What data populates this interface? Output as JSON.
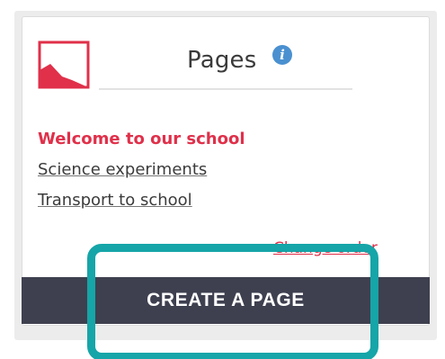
{
  "widget": {
    "title": "Pages",
    "info_icon": "info-icon",
    "info_glyph": "i"
  },
  "pages": {
    "items": [
      {
        "label": "Welcome to our school",
        "current": true
      },
      {
        "label": "Science experiments",
        "current": false
      },
      {
        "label": "Transport to school",
        "current": false
      }
    ],
    "change_order_label": "Change order"
  },
  "actions": {
    "create_label": "CREATE A PAGE"
  },
  "colors": {
    "accent": "#e0304a",
    "bar": "#3e4050",
    "highlight": "#16a5a8",
    "info": "#4a90d0"
  }
}
